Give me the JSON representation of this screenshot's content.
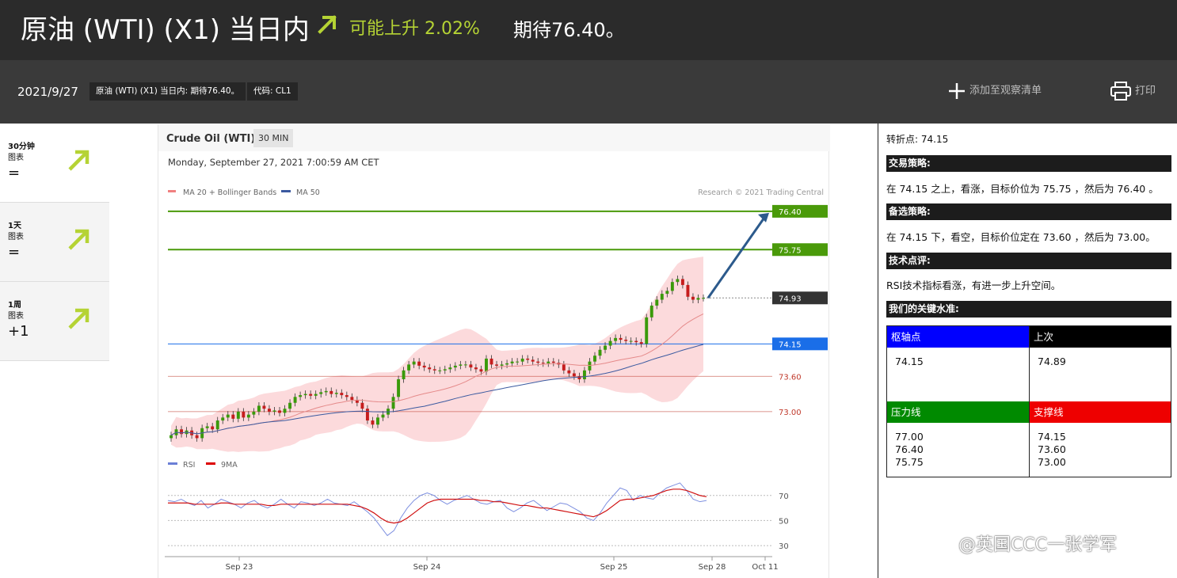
{
  "header": {
    "title": "原油 (WTI) (X1) 当日内",
    "trend": "可能上升 2.02%",
    "target": "期待76.40。",
    "accent_color": "#b5d334"
  },
  "subheader": {
    "date": "2021/9/27",
    "chip_name": "原油 (WTI) (X1) 当日内: 期待76.40。",
    "chip_code": "代码: CL1",
    "watchlist": "添加至观察清单",
    "print": "打印"
  },
  "timeframes": [
    {
      "label": "30分钟",
      "sub": "图表",
      "signal": "="
    },
    {
      "label": "1天",
      "sub": "图表",
      "signal": "="
    },
    {
      "label": "1周",
      "sub": "图表",
      "signal": "+1"
    }
  ],
  "chart": {
    "name": "Crude Oil (WTI)",
    "interval": "30 MIN",
    "datetime": "Monday, September 27, 2021 7:00:59 AM CET",
    "legend_ma20": "MA 20 + Bollinger Bands",
    "legend_ma50": "MA 50",
    "credit": "Research © 2021 Trading Central",
    "rsi_legend": "RSI",
    "ma9_legend": "9MA"
  },
  "chart_data": {
    "type": "candlestick",
    "price_min": 72.3,
    "price_max": 76.6,
    "levels": [
      {
        "label": "76.40",
        "value": 76.4,
        "kind": "target",
        "color": "#4a9a0a"
      },
      {
        "label": "75.75",
        "value": 75.75,
        "kind": "target",
        "color": "#4a9a0a"
      },
      {
        "label": "74.93",
        "value": 74.93,
        "kind": "last",
        "color": "#333333"
      },
      {
        "label": "74.15",
        "value": 74.15,
        "kind": "pivot",
        "color": "#1a6ee8"
      },
      {
        "label": "73.60",
        "value": 73.6,
        "kind": "support",
        "color": "#c0392b"
      },
      {
        "label": "73.00",
        "value": 73.0,
        "kind": "support",
        "color": "#c0392b"
      }
    ],
    "closes": [
      72.6,
      72.7,
      72.62,
      72.68,
      72.6,
      72.55,
      72.72,
      72.75,
      72.7,
      72.85,
      72.9,
      72.95,
      72.88,
      73.0,
      72.9,
      72.95,
      73.0,
      73.1,
      73.05,
      73.0,
      73.02,
      72.98,
      73.05,
      73.15,
      73.25,
      73.28,
      73.3,
      73.27,
      73.3,
      73.33,
      73.35,
      73.3,
      73.32,
      73.28,
      73.25,
      73.2,
      73.15,
      73.05,
      72.85,
      72.78,
      72.9,
      72.95,
      73.05,
      73.25,
      73.55,
      73.7,
      73.8,
      73.85,
      73.78,
      73.75,
      73.72,
      73.7,
      73.7,
      73.72,
      73.75,
      73.78,
      73.8,
      73.8,
      73.75,
      73.72,
      73.68,
      73.9,
      73.8,
      73.78,
      73.8,
      73.82,
      73.85,
      73.85,
      73.9,
      73.88,
      73.85,
      73.83,
      73.82,
      73.85,
      73.83,
      73.8,
      73.7,
      73.65,
      73.6,
      73.55,
      73.7,
      73.85,
      73.95,
      74.05,
      74.12,
      74.2,
      74.25,
      74.22,
      74.2,
      74.2,
      74.18,
      74.15,
      74.6,
      74.8,
      74.9,
      75.0,
      75.05,
      75.2,
      75.25,
      75.15,
      74.95,
      74.9,
      74.93,
      74.93
    ],
    "rsi_ticks": [
      "70",
      "50",
      "30"
    ],
    "rsi": [
      66,
      65,
      67,
      64,
      62,
      66,
      60,
      63,
      67,
      65,
      63,
      60,
      64,
      66,
      62,
      60,
      63,
      67,
      63,
      60,
      65,
      64,
      62,
      64,
      67,
      64,
      63,
      62,
      65,
      61,
      57,
      52,
      45,
      38,
      42,
      52,
      60,
      66,
      70,
      72,
      70,
      66,
      63,
      66,
      68,
      70,
      67,
      64,
      63,
      65,
      66,
      60,
      57,
      60,
      64,
      66,
      62,
      58,
      61,
      64,
      63,
      60,
      57,
      52,
      50,
      56,
      64,
      70,
      76,
      74,
      66,
      70,
      68,
      67,
      72,
      76,
      78,
      80,
      74,
      67,
      65,
      66
    ],
    "ma9": [
      64,
      64,
      64,
      64,
      63,
      63,
      63,
      63,
      64,
      64,
      63,
      63,
      63,
      63,
      63,
      62,
      62,
      63,
      63,
      63,
      63,
      63,
      63,
      63,
      63,
      63,
      63,
      63,
      62,
      61,
      59,
      56,
      52,
      49,
      48,
      49,
      52,
      56,
      60,
      64,
      66,
      67,
      67,
      67,
      67,
      67,
      67,
      66,
      66,
      65,
      65,
      64,
      63,
      62,
      62,
      61,
      60,
      60,
      59,
      58,
      57,
      56,
      55,
      54,
      53,
      55,
      58,
      62,
      66,
      67,
      67,
      68,
      69,
      70,
      72,
      74,
      75,
      75,
      74,
      72,
      70,
      69
    ],
    "x_ticks": [
      "Sep 23",
      "Sep 24",
      "Sep 25",
      "Sep 28",
      "Oct 11"
    ]
  },
  "strategy": {
    "pivot_line": "转折点: 74.15",
    "trading_title": "交易策略:",
    "trading_text": "在 74.15 之上，看涨，目标价位为 75.75 ，然后为 76.40 。",
    "alt_title": "备选策略:",
    "alt_text": "在 74.15 下，看空，目标价位定在 73.60 ，然后为 73.00。",
    "tech_title": "技术点评:",
    "tech_text": "RSI技术指标看涨，有进一步上升空间。",
    "levels_title": "我们的关键水准:"
  },
  "key_levels": {
    "pivot_label": "枢轴点",
    "pivot_value": "74.15",
    "last_label": "上次",
    "last_value": "74.89",
    "resistance_label": "压力线",
    "resistance": [
      "77.00",
      "76.40",
      "75.75"
    ],
    "support_label": "支撑线",
    "support": [
      "74.15",
      "73.60",
      "73.00"
    ],
    "colors": {
      "pivot": "#0000ff",
      "last": "#000000",
      "resistance": "#008a00",
      "support": "#ee0000"
    }
  },
  "watermark": "@英国CCC一张学军"
}
